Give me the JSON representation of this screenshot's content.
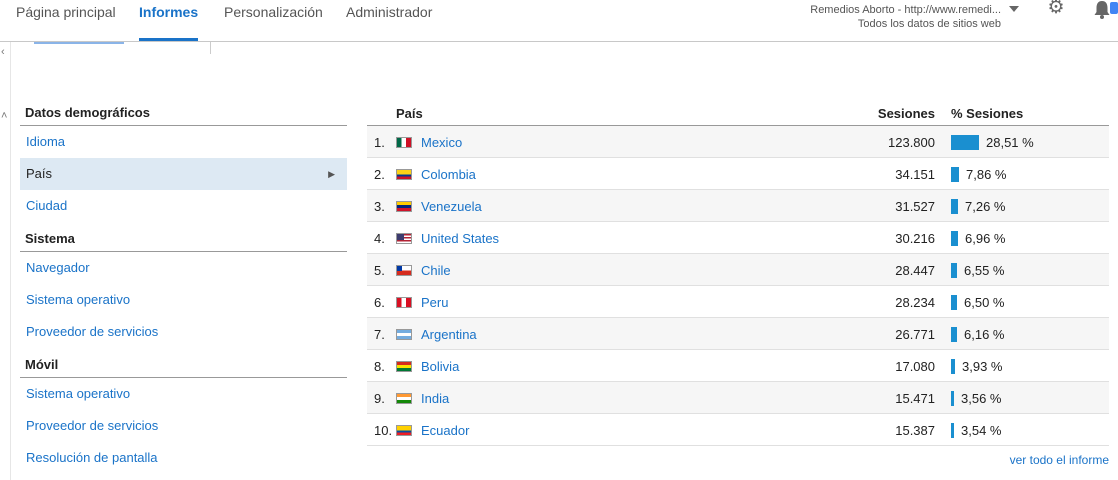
{
  "nav": {
    "tabs": [
      {
        "label": "Página principal"
      },
      {
        "label": "Informes"
      },
      {
        "label": "Personalización"
      },
      {
        "label": "Administrador"
      }
    ],
    "account_name": "Remedios Aborto - http://www.remedi...",
    "account_view": "Todos los datos de sitios web"
  },
  "sidebar": {
    "sections": [
      {
        "title": "Datos demográficos",
        "items": [
          {
            "label": "Idioma"
          },
          {
            "label": "País"
          },
          {
            "label": "Ciudad"
          }
        ]
      },
      {
        "title": "Sistema",
        "items": [
          {
            "label": "Navegador"
          },
          {
            "label": "Sistema operativo"
          },
          {
            "label": "Proveedor de servicios"
          }
        ]
      },
      {
        "title": "Móvil",
        "items": [
          {
            "label": "Sistema operativo"
          },
          {
            "label": "Proveedor de servicios"
          },
          {
            "label": "Resolución de pantalla"
          }
        ]
      }
    ]
  },
  "table": {
    "headers": {
      "country": "País",
      "sessions": "Sesiones",
      "pct": "% Sesiones"
    },
    "rows": [
      {
        "rank": "1.",
        "country": "Mexico",
        "flag": "mx",
        "sessions": "123.800",
        "pct": "28,51 %",
        "pct_value": 28.51
      },
      {
        "rank": "2.",
        "country": "Colombia",
        "flag": "co",
        "sessions": "34.151",
        "pct": "7,86 %",
        "pct_value": 7.86
      },
      {
        "rank": "3.",
        "country": "Venezuela",
        "flag": "ve",
        "sessions": "31.527",
        "pct": "7,26 %",
        "pct_value": 7.26
      },
      {
        "rank": "4.",
        "country": "United States",
        "flag": "us",
        "sessions": "30.216",
        "pct": "6,96 %",
        "pct_value": 6.96
      },
      {
        "rank": "5.",
        "country": "Chile",
        "flag": "cl",
        "sessions": "28.447",
        "pct": "6,55 %",
        "pct_value": 6.55
      },
      {
        "rank": "6.",
        "country": "Peru",
        "flag": "pe",
        "sessions": "28.234",
        "pct": "6,50 %",
        "pct_value": 6.5
      },
      {
        "rank": "7.",
        "country": "Argentina",
        "flag": "ar",
        "sessions": "26.771",
        "pct": "6,16 %",
        "pct_value": 6.16
      },
      {
        "rank": "8.",
        "country": "Bolivia",
        "flag": "bo",
        "sessions": "17.080",
        "pct": "3,93 %",
        "pct_value": 3.93
      },
      {
        "rank": "9.",
        "country": "India",
        "flag": "in",
        "sessions": "15.471",
        "pct": "3,56 %",
        "pct_value": 3.56
      },
      {
        "rank": "10.",
        "country": "Ecuador",
        "flag": "ec",
        "sessions": "15.387",
        "pct": "3,54 %",
        "pct_value": 3.54
      }
    ],
    "footer_link": "ver todo el informe"
  },
  "colors": {
    "accent": "#1a73c8",
    "bar": "#1a8fd0",
    "selected_bg": "#dde9f3"
  }
}
